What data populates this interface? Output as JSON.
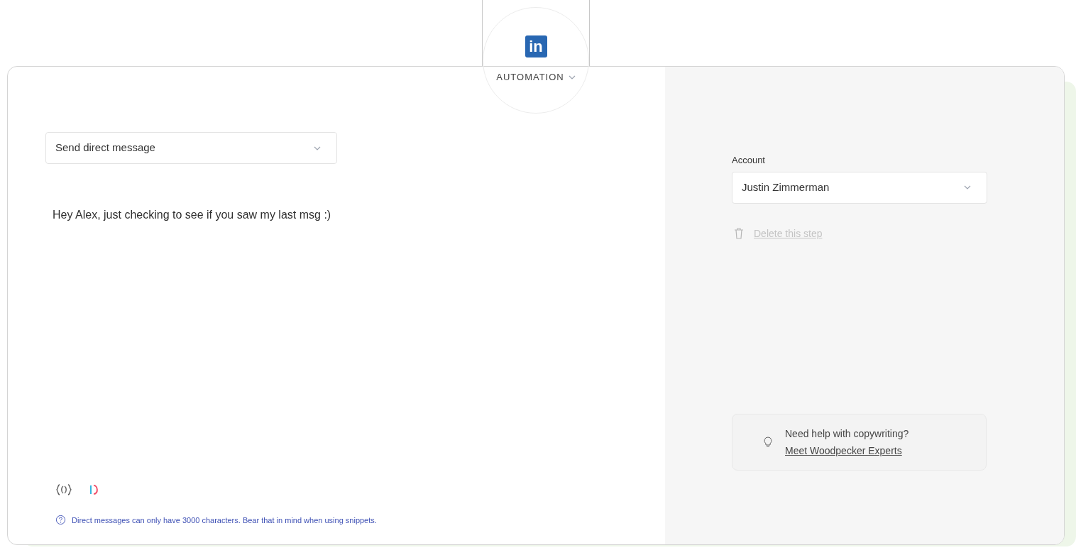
{
  "channel_tab": {
    "logo": "in",
    "label": "AUTOMATION"
  },
  "step_select": {
    "value": "Send direct message"
  },
  "message": {
    "value": "Hey Alex, just checking to see if you saw my last msg :)"
  },
  "hint": "Direct messages can only have 3000 characters. Bear that in mind when using snippets.",
  "account": {
    "label": "Account",
    "value": "Justin Zimmerman"
  },
  "delete_step": {
    "label": "Delete this step",
    "disabled": true
  },
  "help_card": {
    "question": "Need help with copywriting?",
    "link": "Meet Woodpecker Experts"
  }
}
